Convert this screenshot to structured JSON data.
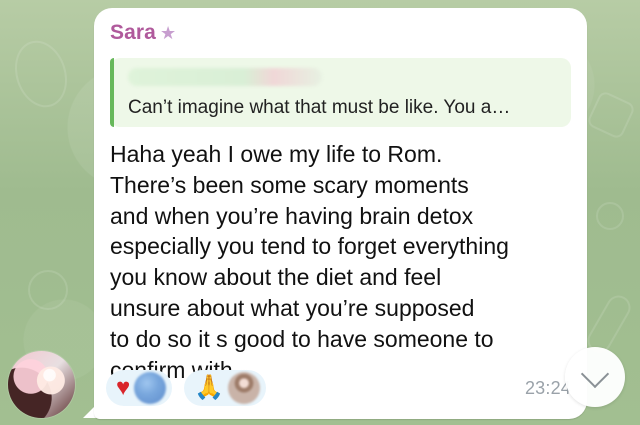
{
  "message": {
    "sender_name": "Sara",
    "sender_icon": "star-icon",
    "reply_preview_text": "Can’t imagine what that must be like. You a…",
    "body_text": "Haha yeah I owe my life to Rom.\nThere’s been some scary moments\nand when you’re having brain detox\nespecially you tend to forget everything\nyou know about the diet and feel\nunsure about what you’re supposed\nto do so it s good to have someone to\nconfirm with",
    "time": "23:24"
  },
  "reactions": [
    {
      "icon": "heart-icon",
      "emoji": "♥"
    },
    {
      "icon": "folded-hands-icon",
      "emoji": "🙏"
    }
  ],
  "controls": {
    "scroll_down_icon": "chevron-down-icon"
  }
}
